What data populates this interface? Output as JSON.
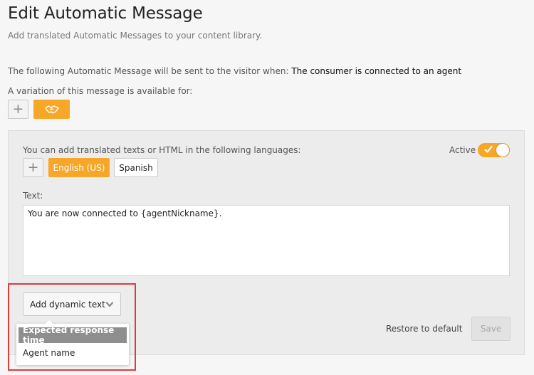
{
  "page": {
    "title": "Edit Automatic Message",
    "subtitle": "Add translated Automatic Messages to your content library."
  },
  "trigger": {
    "prefix": "The following Automatic Message will be sent to the visitor when:",
    "value": "The consumer is connected to an agent"
  },
  "variation": {
    "label": "A variation of this message is available for:",
    "add_symbol": "+",
    "icon": "handshake-icon"
  },
  "languages": {
    "label": "You can add translated texts or HTML in the following languages:",
    "add_symbol": "+",
    "items": [
      "English (US)",
      "Spanish"
    ],
    "selected": "English (US)"
  },
  "status": {
    "label": "Active",
    "active": true
  },
  "text": {
    "label": "Text:",
    "value": "You are now connected to {agentNickname}."
  },
  "dynamic_text": {
    "button_label": "Add dynamic text",
    "options": [
      "Expected response time",
      "Agent name"
    ],
    "highlighted": "Expected response time"
  },
  "actions": {
    "restore_label": "Restore to default",
    "save_label": "Save"
  },
  "colors": {
    "accent": "#f7a727",
    "highlight_border": "#e23a3a"
  }
}
